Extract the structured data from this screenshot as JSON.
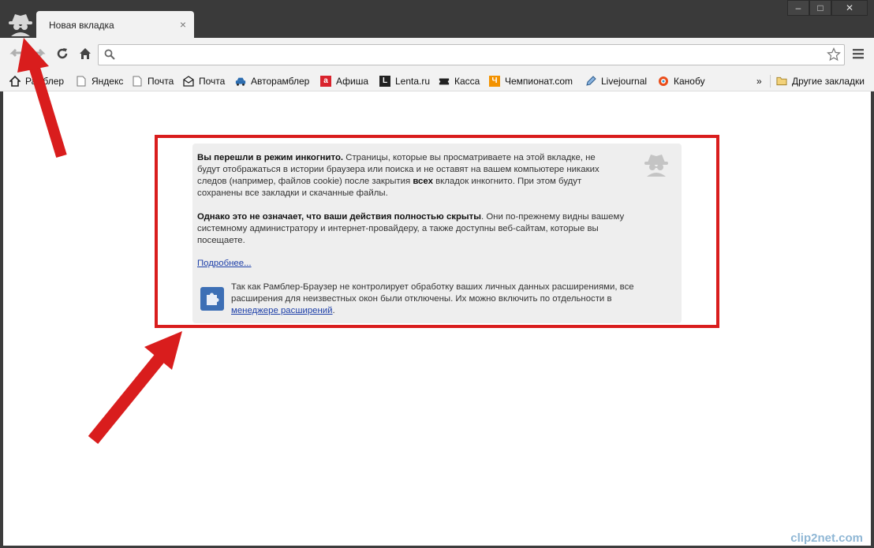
{
  "window": {
    "tab_title": "Новая вкладка",
    "tab_close": "×",
    "controls": {
      "minimize": "‒",
      "maximize": "□",
      "close": "✕"
    }
  },
  "toolbar": {
    "omnibox_value": ""
  },
  "bookmarks": {
    "items": [
      {
        "label": "Рамблер",
        "icon": "home-icon"
      },
      {
        "label": "Яндекс",
        "icon": "page-icon"
      },
      {
        "label": "Почта",
        "icon": "page-icon"
      },
      {
        "label": "Почта",
        "icon": "mail-icon"
      },
      {
        "label": "Авторамблер",
        "icon": "car-icon"
      },
      {
        "label": "Афиша",
        "icon": "afisha-icon",
        "color": "#d9232d",
        "glyph": "a"
      },
      {
        "label": "Lenta.ru",
        "icon": "lenta-icon",
        "color": "#222222",
        "glyph": "L"
      },
      {
        "label": "Касса",
        "icon": "ticket-icon"
      },
      {
        "label": "Чемпионат.com",
        "icon": "championat-icon",
        "color": "#f39200",
        "glyph": "Ч"
      },
      {
        "label": "Livejournal",
        "icon": "pencil-icon"
      },
      {
        "label": "Канобу",
        "icon": "kanobu-icon"
      }
    ],
    "overflow": "»",
    "other_bookmarks": "Другие закладки"
  },
  "incognito": {
    "p1_bold": "Вы перешли в режим инкогнито.",
    "p1_line1": " Страницы, которые вы просматриваете на этой вкладке, не",
    "p1_line2": "будут отображаться в истории браузера или поиска и не оставят на вашем компьютере никаких",
    "p1_line3a": "следов (например, файлов cookie) после закрытия ",
    "p1_line3_bold": "всех",
    "p1_line3b": " вкладок инкогнито. При этом будут",
    "p1_line4": "сохранены все закладки и скачанные файлы.",
    "p2_bold": "Однако это не означает, что ваши действия полностью скрыты",
    "p2_line1": ". Они по-прежнему видны вашему",
    "p2_line2": "системному администратору и интернет-провайдеру, а также доступны веб-сайтам, которые вы",
    "p2_line3": "посещаете.",
    "more_link": "Подробнее...",
    "ext_line1": "Так как Рамблер-Браузер не контролирует обработку ваших личных данных расширениями, все",
    "ext_line2": "расширения для неизвестных окон были отключены. Их можно включить по отдельности в",
    "ext_link": "менеджере расширений",
    "ext_end": "."
  },
  "watermark": "clip2net.com",
  "colors": {
    "highlight": "#d91d1d",
    "link": "#1d3fa8"
  }
}
